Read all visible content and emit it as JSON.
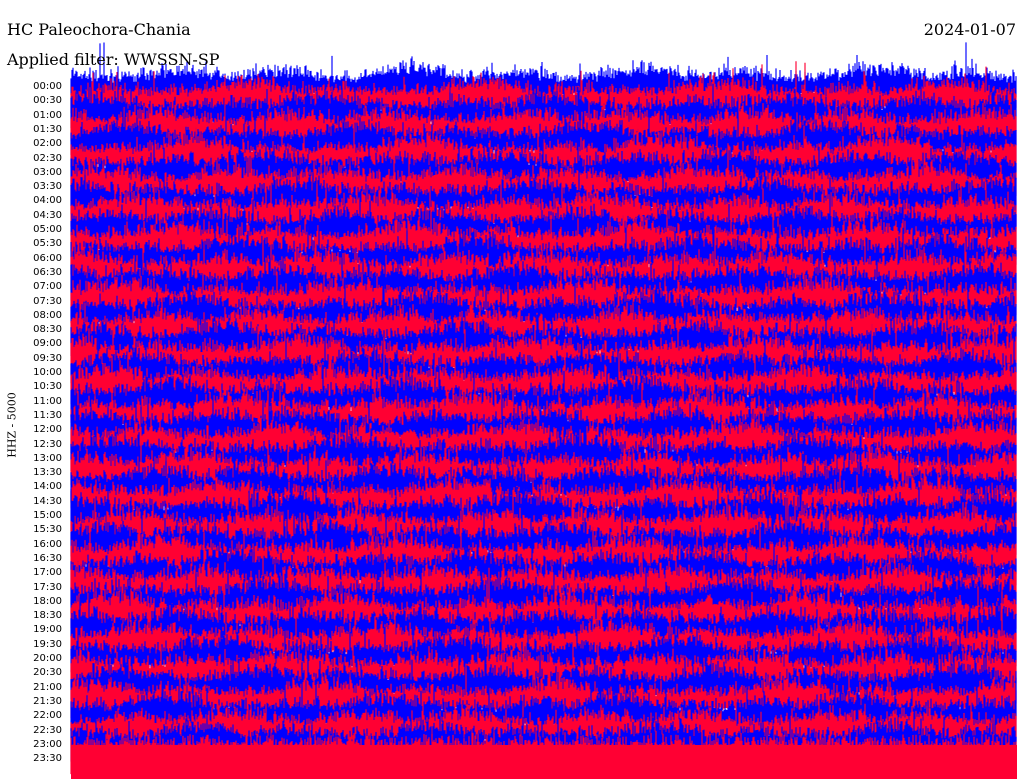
{
  "header": {
    "station": "HC Paleochora-Chania",
    "date": "2024-01-07",
    "filter": "Applied filter: WWSSN-SP"
  },
  "chart_data": {
    "type": "line",
    "title": "HC Paleochora-Chania",
    "date": "2024-01-07",
    "filter": "WWSSN-SP",
    "ylabel": "HHZ - 5000",
    "y_tick_labels": [
      "00:00",
      "00:30",
      "01:00",
      "01:30",
      "02:00",
      "02:30",
      "03:00",
      "03:30",
      "04:00",
      "04:30",
      "05:00",
      "05:30",
      "06:00",
      "06:30",
      "07:00",
      "07:30",
      "08:00",
      "08:30",
      "09:00",
      "09:30",
      "10:00",
      "10:30",
      "11:00",
      "11:30",
      "12:00",
      "12:30",
      "13:00",
      "13:30",
      "14:00",
      "14:30",
      "15:00",
      "15:30",
      "16:00",
      "16:30",
      "17:00",
      "17:30",
      "18:00",
      "18:30",
      "19:00",
      "19:30",
      "20:00",
      "20:30",
      "21:00",
      "21:30",
      "22:00",
      "22:30",
      "23:00",
      "23:30"
    ],
    "traces": 48,
    "trace_interval_minutes": 30,
    "trace_colors": [
      "#0000ff",
      "#ff0033"
    ],
    "grid": false
  }
}
